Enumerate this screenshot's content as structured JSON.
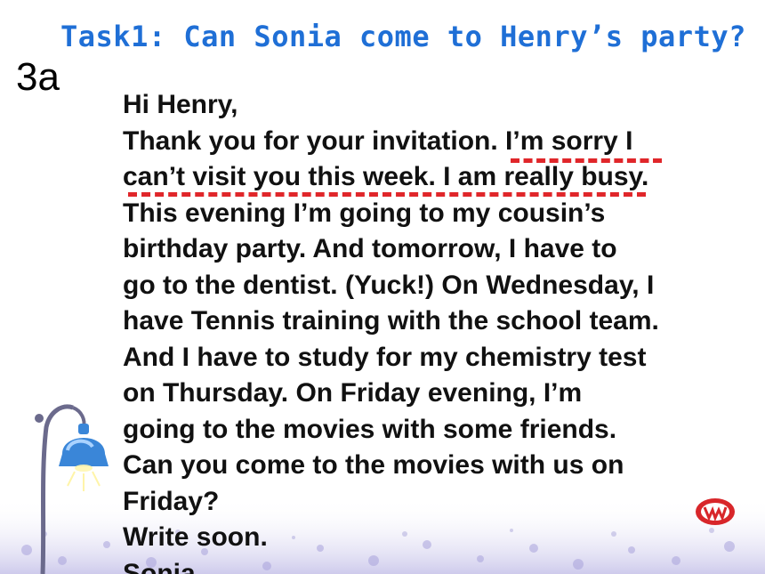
{
  "title": "Task1: Can Sonia come to Henry’s party?",
  "slide_label": "3a",
  "letter": {
    "lines": [
      "Hi Henry,",
      "Thank you for your invitation. I’m sorry I",
      "can’t visit you this week. I am really busy.",
      "This evening I’m going to my cousin’s",
      "birthday party. And tomorrow, I have to",
      "go to the dentist. (Yuck!) On Wednesday, I",
      "have Tennis training with the school team.",
      "And I have to study for my chemistry test",
      "on Thursday. On Friday evening, I’m",
      "going to the movies with some friends.",
      "Can you come to the movies with us on",
      "Friday?",
      "Write soon.",
      "Sonia"
    ]
  },
  "colors": {
    "title": "#1f6fd6",
    "underline": "#e0262a",
    "text": "#111111"
  },
  "icons": {
    "lamp": "bell-lamp-icon",
    "logo": "publisher-logo-icon"
  }
}
